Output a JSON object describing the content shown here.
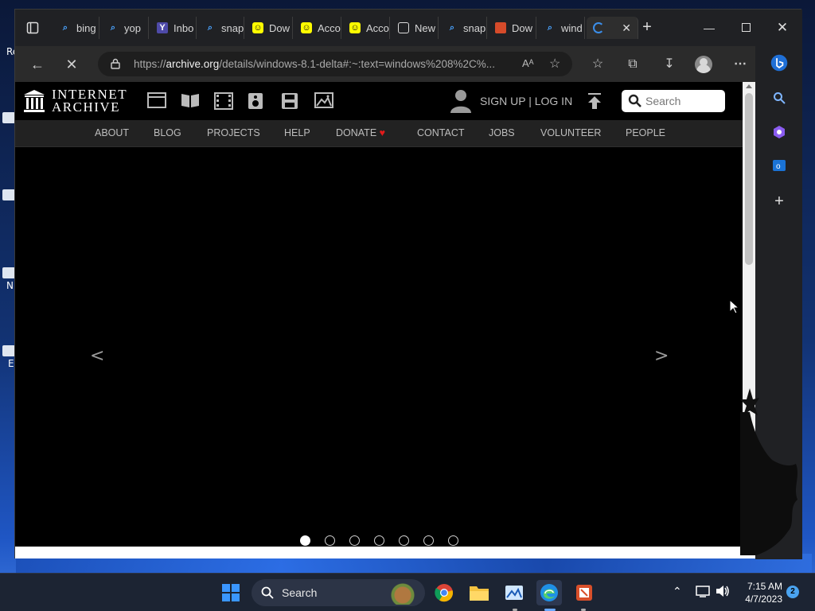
{
  "browser": {
    "tabs": [
      {
        "label": "bing",
        "icon": "search-icon"
      },
      {
        "label": "yop",
        "icon": "search-icon"
      },
      {
        "label": "Inbo",
        "icon": "yahoo-icon"
      },
      {
        "label": "snap",
        "icon": "search-icon"
      },
      {
        "label": "Dow",
        "icon": "snapchat-icon"
      },
      {
        "label": "Acco",
        "icon": "snapchat-icon"
      },
      {
        "label": "Acco",
        "icon": "snapchat-icon"
      },
      {
        "label": "New",
        "icon": "news-icon"
      },
      {
        "label": "snap",
        "icon": "search-icon"
      },
      {
        "label": "Dow",
        "icon": "mail-icon"
      },
      {
        "label": "wind",
        "icon": "search-icon"
      },
      {
        "label": "",
        "icon": "loading-icon",
        "active": true
      }
    ],
    "url_prefix": "https://",
    "url_domain": "archive.org",
    "url_rest": "/details/windows-8.1-delta#:~:text=windows%208%2C%...",
    "url_read_aloud": "Aᴬ"
  },
  "ia": {
    "logo_line1": "INTERNET",
    "logo_line2": "ARCHIVE",
    "media_icons": [
      "web-icon",
      "texts-icon",
      "video-icon",
      "audio-icon",
      "software-icon",
      "images-icon"
    ],
    "signup_label": "SIGN UP | LOG IN",
    "search_placeholder": "Search",
    "nav": [
      "ABOUT",
      "BLOG",
      "PROJECTS",
      "HELP",
      "DONATE",
      "CONTACT",
      "JOBS",
      "VOLUNTEER",
      "PEOPLE"
    ],
    "carousel_prev": "<",
    "carousel_next": ">",
    "carousel_dots": 7,
    "carousel_active_dot": 0
  },
  "taskbar": {
    "search_label": "Search",
    "time": "7:15 AM",
    "date": "4/7/2023",
    "notification_count": "2"
  },
  "desktop": {
    "labels": [
      "Re",
      "N",
      "E"
    ]
  },
  "colors": {
    "donate_heart": "#e21b1b",
    "edge_blue": "#1f8fe6",
    "windows_blue": "#3a96ff"
  }
}
